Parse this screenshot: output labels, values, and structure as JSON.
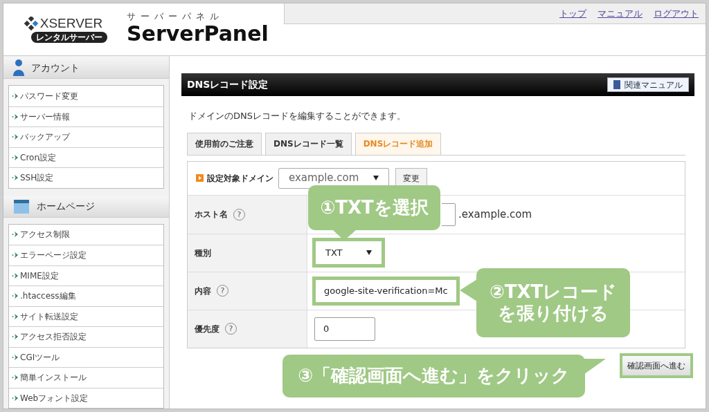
{
  "header": {
    "brand": "XSERVER",
    "badge": "レンタルサーバー",
    "subtitle": "サーバーパネル",
    "title": "ServerPanel",
    "links": [
      "トップ",
      "マニュアル",
      "ログアウト"
    ]
  },
  "sidebar": [
    {
      "title": "アカウント",
      "kind": "account",
      "items": [
        "パスワード変更",
        "サーバー情報",
        "バックアップ",
        "Cron設定",
        "SSH設定"
      ]
    },
    {
      "title": "ホームページ",
      "kind": "homepage",
      "items": [
        "アクセス制限",
        "エラーページ設定",
        "MIME設定",
        ".htaccess編集",
        "サイト転送設定",
        "アクセス拒否設定",
        "CGIツール",
        "簡単インストール",
        "Webフォント設定"
      ]
    }
  ],
  "main": {
    "title": "DNSレコード設定",
    "manual_button": "関連マニュアル",
    "description": "ドメインのDNSレコードを編集することができます。",
    "tabs": [
      {
        "label": "使用前のご注意",
        "selected": false
      },
      {
        "label": "DNSレコード一覧",
        "selected": false
      },
      {
        "label": "DNSレコード追加",
        "selected": true
      }
    ],
    "domain_row": {
      "label": "設定対象ドメイン",
      "value": "example.com",
      "button": "変更"
    },
    "rows": [
      {
        "kind": "host",
        "label": "ホスト名",
        "help": "?",
        "value": "",
        "suffix": ".example.com",
        "highlighted": false
      },
      {
        "kind": "select",
        "label": "種別",
        "value": "TXT",
        "highlighted": true
      },
      {
        "kind": "input",
        "label": "内容",
        "help": "?",
        "value": "google-site-verification=Mc",
        "highlighted": true
      },
      {
        "kind": "small_input",
        "label": "優先度",
        "help": "?",
        "value": "0",
        "highlighted": false
      }
    ],
    "submit": {
      "label": "確認画面へ進む",
      "highlighted": true
    }
  },
  "callouts": [
    {
      "lines": [
        "①TXTを選択"
      ]
    },
    {
      "lines": [
        "②TXTレコード",
        "を張り付ける"
      ]
    },
    {
      "lines": [
        "③「確認画面へ進む」をクリック"
      ]
    }
  ]
}
